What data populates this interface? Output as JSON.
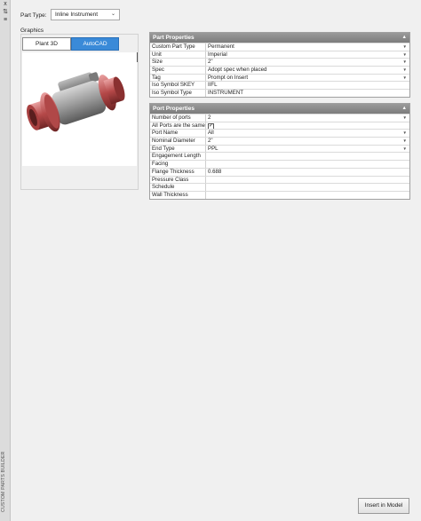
{
  "side_strip": {
    "controls": [
      "x",
      "⇅",
      "≡"
    ],
    "title": "CUSTOM PARTS BUILDER"
  },
  "part_type": {
    "label": "Part Type:",
    "value": "Inline Instrument"
  },
  "graphics": {
    "label": "Graphics",
    "tabs": [
      "Plant 3D Shape",
      "AutoCAD Block"
    ],
    "close_label": "X"
  },
  "part_properties": {
    "header": "Part Properties",
    "rows": [
      {
        "key": "Custom Part Type",
        "value": "Permanent",
        "dropdown": true
      },
      {
        "key": "Unit",
        "value": "Imperial",
        "dropdown": true
      },
      {
        "key": "Size",
        "value": "2\"",
        "dropdown": true
      },
      {
        "key": "Spec",
        "value": "Adopt spec when placed",
        "dropdown": true
      },
      {
        "key": "Tag",
        "value": "Prompt on Insert",
        "dropdown": true
      },
      {
        "key": "Iso Symbol SKEY",
        "value": "IIFL",
        "dropdown": false
      },
      {
        "key": "Iso Symbol Type",
        "value": "INSTRUMENT",
        "dropdown": false
      }
    ]
  },
  "port_properties": {
    "header": "Port Properties",
    "rows": [
      {
        "key": "Number of ports",
        "value": "2",
        "dropdown": true
      },
      {
        "key": "All Ports are the same",
        "value": "✓",
        "checkbox": true
      },
      {
        "key": "Port Name",
        "value": "All",
        "dropdown": true
      },
      {
        "key": "Nominal Diameter",
        "value": "2\"",
        "dropdown": true
      },
      {
        "key": "End Type",
        "value": "PPL",
        "dropdown": true
      },
      {
        "key": "Engagement Length",
        "value": "",
        "dropdown": false
      },
      {
        "key": "Facing",
        "value": "",
        "dropdown": false
      },
      {
        "key": "Flange Thickness",
        "value": "0.688",
        "dropdown": false
      },
      {
        "key": "Pressure Class",
        "value": "",
        "dropdown": false
      },
      {
        "key": "Schedule",
        "value": "",
        "dropdown": false
      },
      {
        "key": "Wall Thickness",
        "value": "",
        "dropdown": false
      }
    ]
  },
  "insert_button": "Insert in Model",
  "colors": {
    "active_tab": "#3a8ad8",
    "header_bg": "#8a8a8a",
    "flange_red": "#c0504d"
  }
}
